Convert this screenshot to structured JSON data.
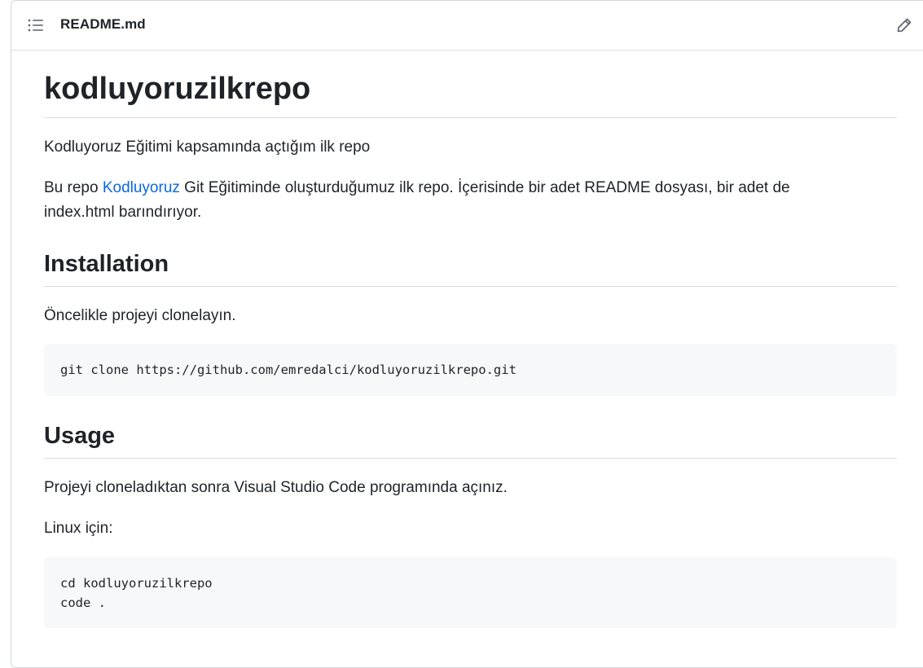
{
  "header": {
    "file_name": "README.md",
    "toc_icon": "list-unordered-icon",
    "edit_icon": "pencil-icon"
  },
  "readme": {
    "title": "kodluyoruzilkrepo",
    "intro": "Kodluyoruz Eğitimi kapsamında açtığım ilk repo",
    "description_prefix": "Bu repo ",
    "description_link": "Kodluyoruz",
    "description_suffix_line1": " Git Eğitiminde oluşturduğumuz ilk repo. İçerisinde bir adet README dosyası, bir adet de",
    "description_line2": "index.html barındırıyor.",
    "installation": {
      "heading": "Installation",
      "text": "Öncelikle projeyi clonelayın.",
      "code": "git clone https://github.com/emredalci/kodluyoruzilkrepo.git"
    },
    "usage": {
      "heading": "Usage",
      "text": "Projeyi cloneladıktan sonra Visual Studio Code programında açınız.",
      "linux_label": "Linux için:",
      "code_line1": "cd kodluyoruzilkrepo",
      "code_line2": "code ."
    }
  },
  "colors": {
    "link": "#0969da",
    "text": "#1f2328",
    "border": "#d0d7de",
    "code_bg": "#f6f8fa"
  }
}
